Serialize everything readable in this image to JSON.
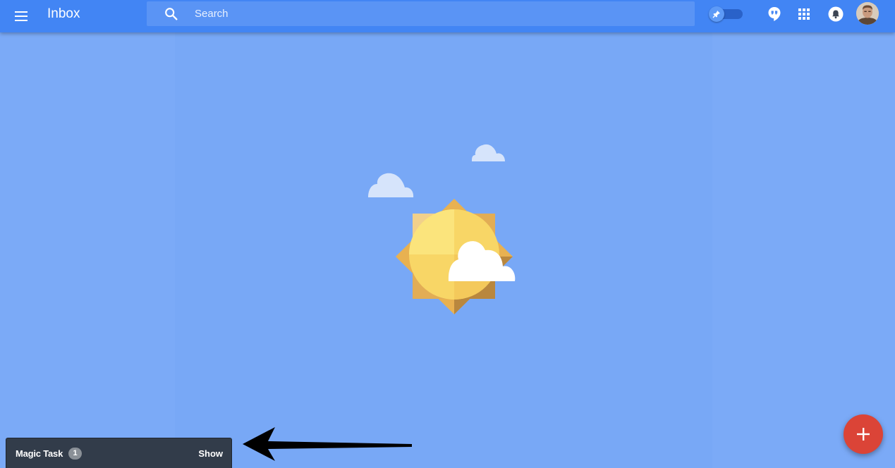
{
  "header": {
    "title": "Inbox",
    "search": {
      "placeholder": "Search",
      "value": ""
    },
    "icons": [
      "menu-icon",
      "search-icon",
      "pin-icon",
      "hangouts-icon",
      "apps-grid-icon",
      "notifications-bell-icon",
      "avatar"
    ]
  },
  "main": {
    "illustration": "sun-with-clouds"
  },
  "magic_task": {
    "label": "Magic Task",
    "count": "1",
    "action": "Show"
  },
  "compose": {
    "icon": "plus-icon"
  },
  "colors": {
    "header": "#4285f4",
    "background": "#7baaf7",
    "fab": "#db4437",
    "magic_task_bar": "#323c4a"
  }
}
